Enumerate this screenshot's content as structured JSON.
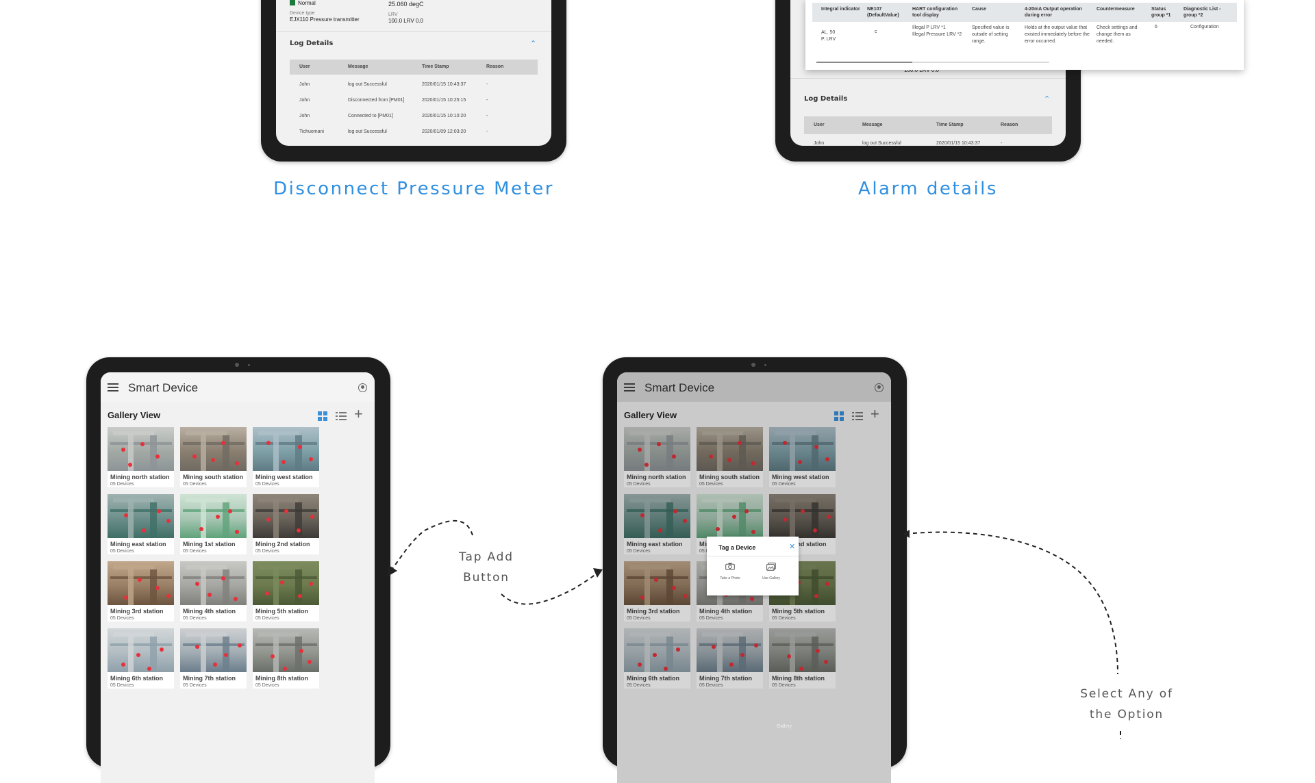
{
  "captions": {
    "disconnect": "Disconnect Pressure Meter",
    "alarm": "Alarm details",
    "tap_add": [
      "Tap Add",
      "Button"
    ],
    "select_option": [
      "Select Any of",
      "the Option"
    ]
  },
  "top_left": {
    "status": "Normal",
    "temp_value": "25.060 degC",
    "device_type_label": "Device type",
    "device_type_value": "EJX110 Pressure transmitter",
    "lrv_label": "LRV",
    "lrv_value": "100.0 LRV 0.0"
  },
  "log": {
    "title": "Log Details",
    "headers": [
      "User",
      "Message",
      "Time Stamp",
      "Reason"
    ],
    "rows": [
      [
        "John",
        "log out Successful",
        "2020/01/15 10:43:37",
        "-"
      ],
      [
        "John",
        "Disconnected from [PM01]",
        "2020/01/15 10:25:15",
        "-"
      ],
      [
        "John",
        "Connected to [PM01]",
        "2020/01/15 10:10:20",
        "-"
      ],
      [
        "Tichuomani",
        "log out Successful",
        "2020/01/09 12:03:20",
        "-"
      ]
    ],
    "partial_row": [
      "John",
      "log out Successful",
      "2020/01/15 10:43:37",
      "-"
    ]
  },
  "alarm_table": {
    "headers": [
      "Integral indicator",
      "NE107 (DefaultValue)",
      "HART configuration tool display",
      "Cause",
      "4-20mA Output operation during error",
      "Countermeasure",
      "Status group *1",
      "Diagnostic List - group *2"
    ],
    "row": [
      "AL. 50\nP. LRV",
      "c",
      "Illegal P LRV *1\nIllegal Pressure LRV *2",
      "Specified value is outside of setting range.",
      "Holds at the output value that existed immediately before the error occurred.",
      "Check settings and change them as needed.",
      "6",
      "Configuration"
    ],
    "behind_value": "100.0 LRV 0.0"
  },
  "app": {
    "title": "Smart Device",
    "gallery_title": "Gallery View",
    "icons": [
      "grid-icon",
      "list-icon",
      "plus-icon",
      "hamburger-icon",
      "account-icon"
    ],
    "tiles": [
      {
        "name": "Mining north station",
        "count": "05 Devices"
      },
      {
        "name": "Mining south station",
        "count": "05 Devices"
      },
      {
        "name": "Mining west station",
        "count": "05 Devices"
      },
      {
        "name": "Mining east station",
        "count": "05 Devices"
      },
      {
        "name": "Mining 1st station",
        "count": "05 Devices"
      },
      {
        "name": "Mining 2nd station",
        "count": "05 Devices"
      },
      {
        "name": "Mining 3rd station",
        "count": "05 Devices"
      },
      {
        "name": "Mining 4th station",
        "count": "05 Devices"
      },
      {
        "name": "Mining 5th station",
        "count": "05 Devices"
      },
      {
        "name": "Mining 6th station",
        "count": "05 Devices"
      },
      {
        "name": "Mining 7th station",
        "count": "05 Devices"
      },
      {
        "name": "Mining 8th station",
        "count": "05 Devices"
      }
    ]
  },
  "dialog": {
    "title": "Tag a Device",
    "option_photo": "Take a Photo",
    "option_gallery": "Use Gallery",
    "gallery_watermark": "Gallery"
  },
  "colors": {
    "accent": "#2f8fe0",
    "status_normal": "#1e7a3c",
    "marker": "#e8303a",
    "tablet": "#1d1d1d"
  }
}
